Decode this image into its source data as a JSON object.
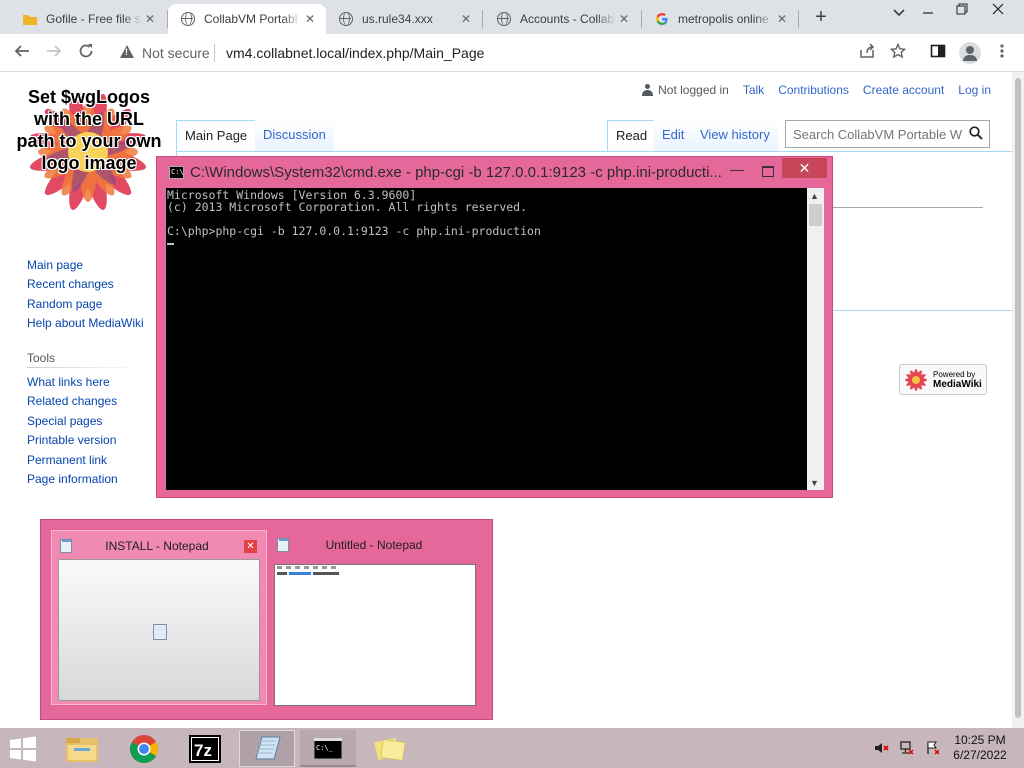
{
  "browser": {
    "tabs": [
      {
        "label": "Gofile - Free file s",
        "favicon": "folder-icon",
        "active": false
      },
      {
        "label": "CollabVM Portabl",
        "favicon": "globe-icon",
        "active": true
      },
      {
        "label": "us.rule34.xxx",
        "favicon": "globe-icon",
        "active": false
      },
      {
        "label": "Accounts - Collab",
        "favicon": "globe-icon",
        "active": false
      },
      {
        "label": "metropolis online",
        "favicon": "google-icon",
        "active": false
      }
    ],
    "security_label": "Not secure",
    "url": "vm4.collabnet.local/index.php/Main_Page"
  },
  "wiki": {
    "logo_text": "Set $wgLogos with the URL path to your own logo image",
    "personal": {
      "not_logged_in": "Not logged in",
      "talk": "Talk",
      "contributions": "Contributions",
      "create_account": "Create account",
      "log_in": "Log in"
    },
    "namespace_tabs": {
      "main_page": "Main Page",
      "discussion": "Discussion"
    },
    "view_tabs": {
      "read": "Read",
      "edit": "Edit",
      "view_history": "View history"
    },
    "search_placeholder": "Search CollabVM Portable W",
    "navigation": [
      "Main page",
      "Recent changes",
      "Random page",
      "Help about MediaWiki"
    ],
    "tools_heading": "Tools",
    "tools": [
      "What links here",
      "Related changes",
      "Special pages",
      "Printable version",
      "Permanent link",
      "Page information"
    ],
    "powered_by": {
      "line1": "Powered by",
      "line2": "MediaWiki"
    }
  },
  "cmd": {
    "title": "C:\\Windows\\System32\\cmd.exe - php-cgi  -b 127.0.0.1:9123 -c php.ini-producti...",
    "lines": [
      "Microsoft Windows [Version 6.3.9600]",
      "(c) 2013 Microsoft Corporation. All rights reserved.",
      "",
      "C:\\php>php-cgi -b 127.0.0.1:9123 -c php.ini-production"
    ]
  },
  "notepad_popup": {
    "windows": [
      {
        "title": "INSTALL - Notepad"
      },
      {
        "title": "Untitled - Notepad"
      }
    ]
  },
  "taskbar": {
    "clock_time": "10:25 PM",
    "clock_date": "6/27/2022"
  }
}
